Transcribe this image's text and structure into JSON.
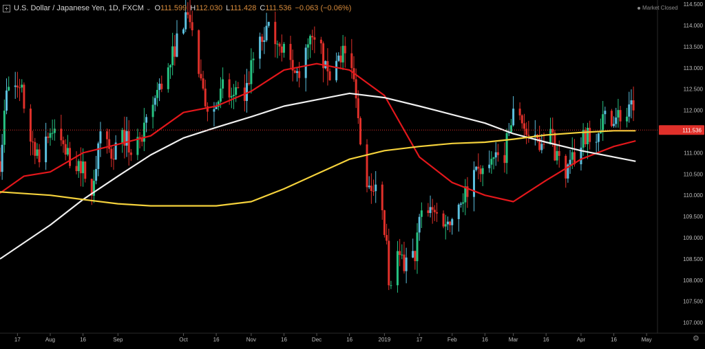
{
  "header": {
    "symbol": "U.S. Dollar / Japanese Yen, 1D, FXCM",
    "open_label": "O",
    "open": "111.599",
    "high_label": "H",
    "high": "112.030",
    "low_label": "L",
    "low": "111.428",
    "close_label": "C",
    "close": "111.536",
    "change": "−0.063 (−0.06%)"
  },
  "status": {
    "market": "Market Closed"
  },
  "colors": {
    "background": "#000000",
    "up": "#26c281",
    "up_alt": "#5bc0de",
    "down": "#e0302a",
    "ma_fast": "#e3171b",
    "ma_mid": "#f0f0f0",
    "ma_slow": "#f5d23c",
    "last_price": "#e0302a"
  },
  "chart_data": {
    "type": "candlestick",
    "x_labels": [
      "17",
      "Aug",
      "16",
      "Sep",
      "Oct",
      "16",
      "Nov",
      "16",
      "Dec",
      "16",
      "2019",
      "17",
      "Feb",
      "16",
      "Mar",
      "16",
      "Apr",
      "16",
      "May"
    ],
    "x_label_dates": [
      "2018-07-17",
      "2018-08-01",
      "2018-08-16",
      "2018-09-01",
      "2018-10-01",
      "2018-10-16",
      "2018-11-01",
      "2018-11-16",
      "2018-12-01",
      "2018-12-16",
      "2019-01-01",
      "2019-01-17",
      "2019-02-01",
      "2019-02-16",
      "2019-03-01",
      "2019-03-16",
      "2019-04-01",
      "2019-04-16",
      "2019-05-01"
    ],
    "x_range": [
      "2018-07-09",
      "2019-05-06"
    ],
    "y_ticks": [
      "114.500",
      "114.000",
      "113.500",
      "113.000",
      "112.500",
      "112.000",
      "111.500",
      "111.000",
      "110.500",
      "110.000",
      "109.500",
      "109.000",
      "108.500",
      "108.000",
      "107.500",
      "107.000"
    ],
    "ylim": [
      106.75,
      114.6
    ],
    "last_price": 111.536,
    "last_price_label": "111.536",
    "grid": false,
    "close_series": [
      [
        "2018-07-09",
        110.8
      ],
      [
        "2018-07-12",
        112.4
      ],
      [
        "2018-07-16",
        112.6
      ],
      [
        "2018-07-19",
        112.4
      ],
      [
        "2018-07-23",
        111.3
      ],
      [
        "2018-07-27",
        111.0
      ],
      [
        "2018-08-02",
        111.6
      ],
      [
        "2018-08-07",
        111.1
      ],
      [
        "2018-08-10",
        110.9
      ],
      [
        "2018-08-15",
        110.7
      ],
      [
        "2018-08-20",
        110.2
      ],
      [
        "2018-08-24",
        111.3
      ],
      [
        "2018-08-29",
        111.0
      ],
      [
        "2018-09-04",
        111.4
      ],
      [
        "2018-09-07",
        111.0
      ],
      [
        "2018-09-12",
        111.3
      ],
      [
        "2018-09-18",
        112.3
      ],
      [
        "2018-09-24",
        112.9
      ],
      [
        "2018-09-28",
        113.7
      ],
      [
        "2018-10-03",
        114.4
      ],
      [
        "2018-10-05",
        113.8
      ],
      [
        "2018-10-10",
        112.3
      ],
      [
        "2018-10-15",
        112.0
      ],
      [
        "2018-10-19",
        112.5
      ],
      [
        "2018-10-24",
        112.3
      ],
      [
        "2018-10-29",
        112.3
      ],
      [
        "2018-11-02",
        113.2
      ],
      [
        "2018-11-08",
        113.9
      ],
      [
        "2018-11-12",
        113.8
      ],
      [
        "2018-11-15",
        113.6
      ],
      [
        "2018-11-20",
        112.8
      ],
      [
        "2018-11-23",
        112.9
      ],
      [
        "2018-11-28",
        113.6
      ],
      [
        "2018-12-03",
        113.4
      ],
      [
        "2018-12-06",
        112.7
      ],
      [
        "2018-12-11",
        113.3
      ],
      [
        "2018-12-14",
        113.4
      ],
      [
        "2018-12-19",
        112.5
      ],
      [
        "2018-12-21",
        111.2
      ],
      [
        "2018-12-24",
        110.4
      ],
      [
        "2018-12-28",
        110.3
      ],
      [
        "2019-01-02",
        108.8
      ],
      [
        "2019-01-03",
        107.7
      ],
      [
        "2019-01-07",
        108.5
      ],
      [
        "2019-01-10",
        108.3
      ],
      [
        "2019-01-15",
        108.6
      ],
      [
        "2019-01-18",
        109.7
      ],
      [
        "2019-01-23",
        109.6
      ],
      [
        "2019-01-29",
        109.4
      ],
      [
        "2019-02-01",
        109.5
      ],
      [
        "2019-02-05",
        109.9
      ],
      [
        "2019-02-11",
        110.4
      ],
      [
        "2019-02-15",
        110.5
      ],
      [
        "2019-02-20",
        110.8
      ],
      [
        "2019-02-25",
        111.0
      ],
      [
        "2019-03-01",
        111.9
      ],
      [
        "2019-03-05",
        111.8
      ],
      [
        "2019-03-08",
        111.2
      ],
      [
        "2019-03-13",
        111.3
      ],
      [
        "2019-03-18",
        111.5
      ],
      [
        "2019-03-21",
        110.8
      ],
      [
        "2019-03-26",
        110.6
      ],
      [
        "2019-03-29",
        110.9
      ],
      [
        "2019-04-03",
        111.4
      ],
      [
        "2019-04-08",
        111.5
      ],
      [
        "2019-04-11",
        111.8
      ],
      [
        "2019-04-16",
        111.9
      ],
      [
        "2019-04-19",
        111.9
      ],
      [
        "2019-04-22",
        111.9
      ],
      [
        "2019-04-24",
        112.0
      ],
      [
        "2019-04-26",
        111.536
      ]
    ],
    "series": [
      {
        "color": "#e3171b",
        "points": [
          [
            "2018-07-09",
            110.05
          ],
          [
            "2018-07-20",
            110.45
          ],
          [
            "2018-08-01",
            110.55
          ],
          [
            "2018-08-16",
            111.0
          ],
          [
            "2018-09-01",
            111.2
          ],
          [
            "2018-09-16",
            111.4
          ],
          [
            "2018-10-01",
            111.95
          ],
          [
            "2018-10-16",
            112.1
          ],
          [
            "2018-11-01",
            112.45
          ],
          [
            "2018-11-16",
            112.95
          ],
          [
            "2018-12-01",
            113.1
          ],
          [
            "2018-12-16",
            112.95
          ],
          [
            "2019-01-01",
            112.35
          ],
          [
            "2019-01-17",
            110.9
          ],
          [
            "2019-02-01",
            110.3
          ],
          [
            "2019-02-16",
            110.0
          ],
          [
            "2019-03-01",
            109.85
          ],
          [
            "2019-03-16",
            110.35
          ],
          [
            "2019-04-01",
            110.85
          ],
          [
            "2019-04-16",
            111.15
          ],
          [
            "2019-04-26",
            111.28
          ]
        ]
      },
      {
        "color": "#f0f0f0",
        "points": [
          [
            "2018-07-09",
            108.5
          ],
          [
            "2018-08-01",
            109.3
          ],
          [
            "2018-08-16",
            109.9
          ],
          [
            "2018-09-01",
            110.45
          ],
          [
            "2018-09-16",
            110.95
          ],
          [
            "2018-10-01",
            111.35
          ],
          [
            "2018-10-16",
            111.6
          ],
          [
            "2018-11-01",
            111.85
          ],
          [
            "2018-11-16",
            112.1
          ],
          [
            "2018-12-01",
            112.25
          ],
          [
            "2018-12-16",
            112.4
          ],
          [
            "2019-01-01",
            112.3
          ],
          [
            "2019-01-17",
            112.1
          ],
          [
            "2019-02-01",
            111.9
          ],
          [
            "2019-02-16",
            111.7
          ],
          [
            "2019-03-01",
            111.45
          ],
          [
            "2019-03-16",
            111.25
          ],
          [
            "2019-04-01",
            111.05
          ],
          [
            "2019-04-16",
            110.9
          ],
          [
            "2019-04-26",
            110.8
          ]
        ]
      },
      {
        "color": "#f5d23c",
        "points": [
          [
            "2018-07-09",
            110.08
          ],
          [
            "2018-08-01",
            110.0
          ],
          [
            "2018-08-16",
            109.9
          ],
          [
            "2018-09-01",
            109.8
          ],
          [
            "2018-09-16",
            109.75
          ],
          [
            "2018-10-01",
            109.75
          ],
          [
            "2018-10-16",
            109.75
          ],
          [
            "2018-11-01",
            109.85
          ],
          [
            "2018-11-16",
            110.15
          ],
          [
            "2018-12-01",
            110.5
          ],
          [
            "2018-12-16",
            110.85
          ],
          [
            "2019-01-01",
            111.05
          ],
          [
            "2019-01-17",
            111.15
          ],
          [
            "2019-02-01",
            111.22
          ],
          [
            "2019-02-16",
            111.25
          ],
          [
            "2019-03-01",
            111.32
          ],
          [
            "2019-03-16",
            111.42
          ],
          [
            "2019-04-01",
            111.48
          ],
          [
            "2019-04-16",
            111.52
          ],
          [
            "2019-04-26",
            111.52
          ]
        ]
      }
    ]
  }
}
